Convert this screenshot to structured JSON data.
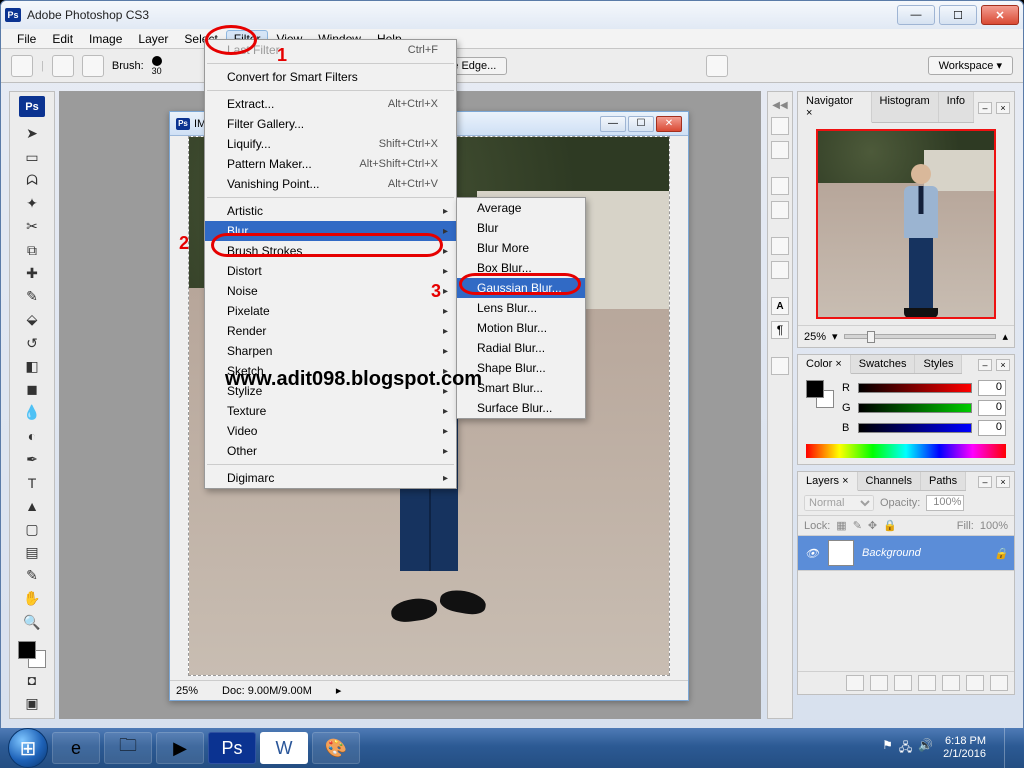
{
  "titlebar": {
    "app_title": "Adobe Photoshop CS3",
    "ps_badge": "Ps"
  },
  "menubar": {
    "items": [
      "File",
      "Edit",
      "Image",
      "Layer",
      "Select",
      "Filter",
      "View",
      "Window",
      "Help"
    ],
    "active_index": 5
  },
  "optbar": {
    "brush_label": "Brush:",
    "brush_size": "30",
    "refine_label": "fine Edge...",
    "workspace_label": "Workspace ▾"
  },
  "filter_menu": {
    "last_filter": {
      "label": "Last Filter",
      "shortcut": "Ctrl+F"
    },
    "convert": "Convert for Smart Filters",
    "group2": [
      {
        "label": "Extract...",
        "shortcut": "Alt+Ctrl+X"
      },
      {
        "label": "Filter Gallery...",
        "shortcut": ""
      },
      {
        "label": "Liquify...",
        "shortcut": "Shift+Ctrl+X"
      },
      {
        "label": "Pattern Maker...",
        "shortcut": "Alt+Shift+Ctrl+X"
      },
      {
        "label": "Vanishing Point...",
        "shortcut": "Alt+Ctrl+V"
      }
    ],
    "subcats": [
      "Artistic",
      "Blur",
      "Brush Strokes",
      "Distort",
      "Noise",
      "Pixelate",
      "Render",
      "Sharpen",
      "Sketch",
      "Stylize",
      "Texture",
      "Video",
      "Other"
    ],
    "highlight_index": 1,
    "digimarc": "Digimarc"
  },
  "blur_submenu": {
    "items": [
      "Average",
      "Blur",
      "Blur More",
      "Box Blur...",
      "Gaussian Blur...",
      "Lens Blur...",
      "Motion Blur...",
      "Radial Blur...",
      "Shape Blur...",
      "Smart Blur...",
      "Surface Blur..."
    ],
    "highlight_index": 4
  },
  "doc": {
    "title": "IMG",
    "zoom": "25%",
    "status_doc": "Doc: 9.00M/9.00M"
  },
  "navigator": {
    "tabs": [
      "Navigator ×",
      "Histogram",
      "Info"
    ],
    "zoom": "25%"
  },
  "color": {
    "tabs": [
      "Color ×",
      "Swatches",
      "Styles"
    ],
    "r_label": "R",
    "g_label": "G",
    "b_label": "B",
    "r": "0",
    "g": "0",
    "b": "0"
  },
  "layers": {
    "tabs": [
      "Layers ×",
      "Channels",
      "Paths"
    ],
    "blend": "Normal",
    "opacity_label": "Opacity:",
    "opacity": "100%",
    "lock_label": "Lock:",
    "fill_label": "Fill:",
    "fill": "100%",
    "item_name": "Background"
  },
  "annotations": {
    "n1": "1",
    "n2": "2",
    "n3": "3",
    "watermark": "www.adit098.blogspot.com"
  },
  "taskbar": {
    "time": "6:18 PM",
    "date": "2/1/2016"
  }
}
